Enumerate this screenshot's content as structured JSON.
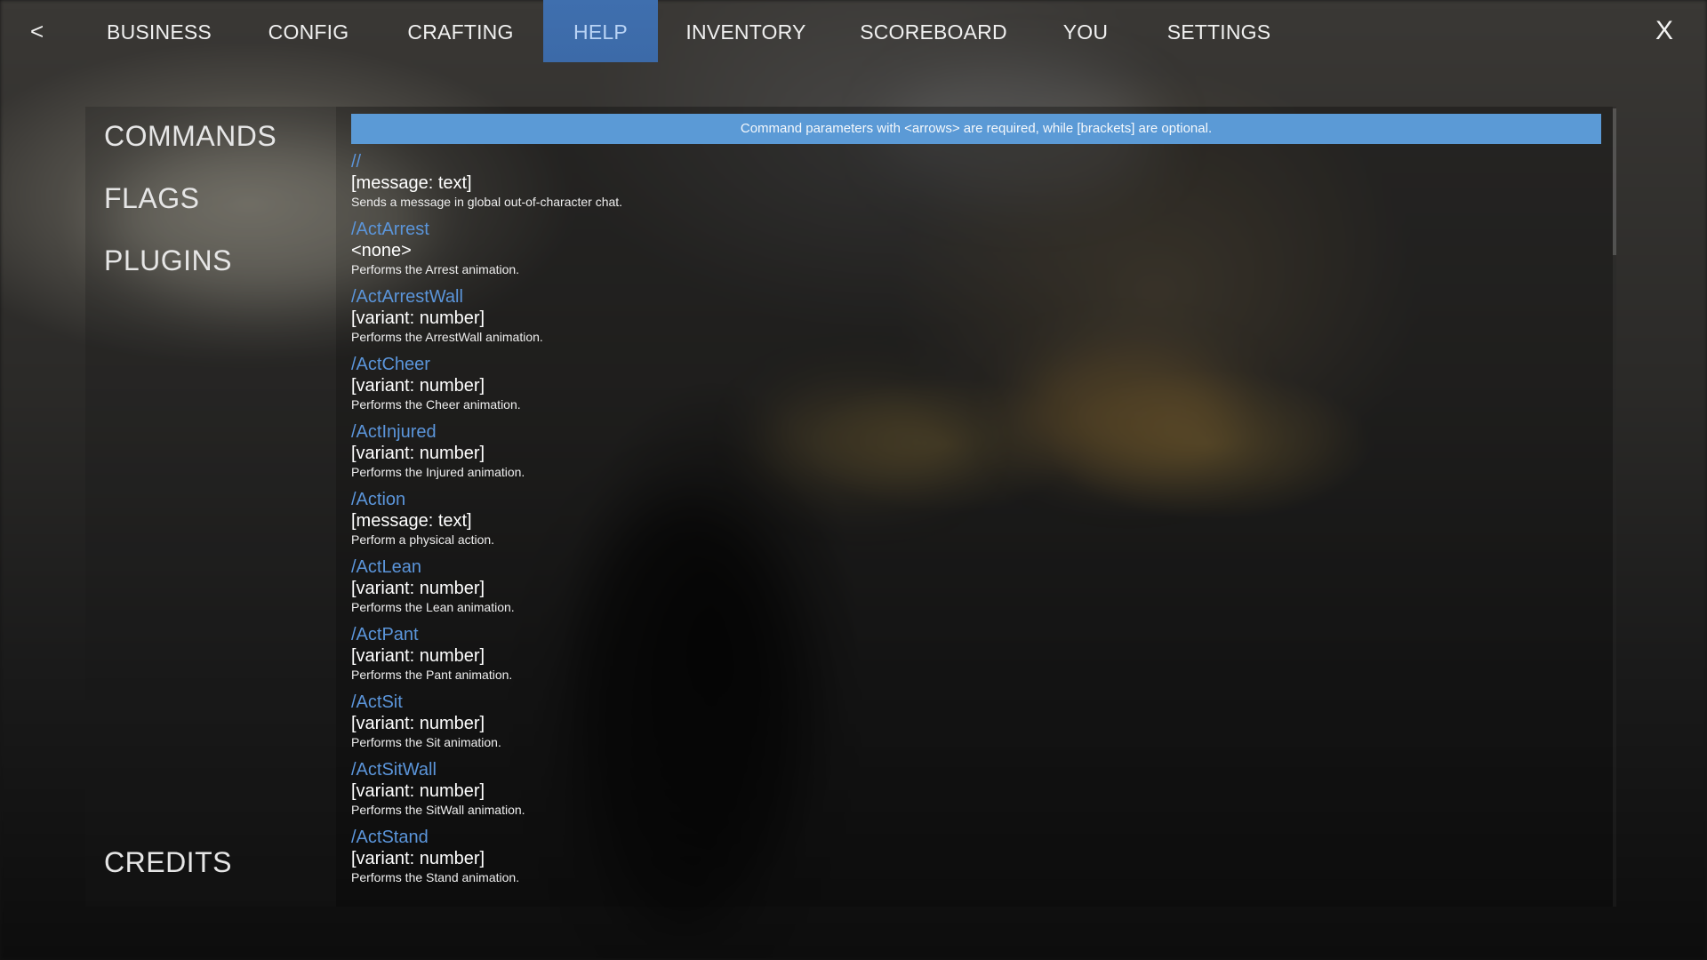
{
  "nav": {
    "back_label": "<",
    "close_label": "X",
    "tabs": [
      {
        "label": "BUSINESS"
      },
      {
        "label": "CONFIG"
      },
      {
        "label": "CRAFTING"
      },
      {
        "label": "HELP"
      },
      {
        "label": "INVENTORY"
      },
      {
        "label": "SCOREBOARD"
      },
      {
        "label": "YOU"
      },
      {
        "label": "SETTINGS"
      }
    ],
    "active_tab": "HELP"
  },
  "sidebar": {
    "items": [
      {
        "label": "COMMANDS"
      },
      {
        "label": "FLAGS"
      },
      {
        "label": "PLUGINS"
      }
    ],
    "footer_label": "CREDITS"
  },
  "help": {
    "notice": "Command parameters with <arrows> are required, while [brackets] are optional.",
    "commands": [
      {
        "name": "//",
        "args": "[message: text]",
        "desc": "Sends a message in global out-of-character chat."
      },
      {
        "name": "/ActArrest",
        "args": "<none>",
        "desc": "Performs the Arrest animation."
      },
      {
        "name": "/ActArrestWall",
        "args": "[variant: number]",
        "desc": "Performs the ArrestWall animation."
      },
      {
        "name": "/ActCheer",
        "args": "[variant: number]",
        "desc": "Performs the Cheer animation."
      },
      {
        "name": "/ActInjured",
        "args": "[variant: number]",
        "desc": "Performs the Injured animation."
      },
      {
        "name": "/Action",
        "args": "[message: text]",
        "desc": "Perform a physical action."
      },
      {
        "name": "/ActLean",
        "args": "[variant: number]",
        "desc": "Performs the Lean animation."
      },
      {
        "name": "/ActPant",
        "args": "[variant: number]",
        "desc": "Performs the Pant animation."
      },
      {
        "name": "/ActSit",
        "args": "[variant: number]",
        "desc": "Performs the Sit animation."
      },
      {
        "name": "/ActSitWall",
        "args": "[variant: number]",
        "desc": "Performs the SitWall animation."
      },
      {
        "name": "/ActStand",
        "args": "[variant: number]",
        "desc": "Performs the Stand animation."
      }
    ]
  },
  "colors": {
    "accent": "#3c6aa8",
    "notice_bg": "#5b9ad6",
    "command_name": "#5b95da"
  }
}
